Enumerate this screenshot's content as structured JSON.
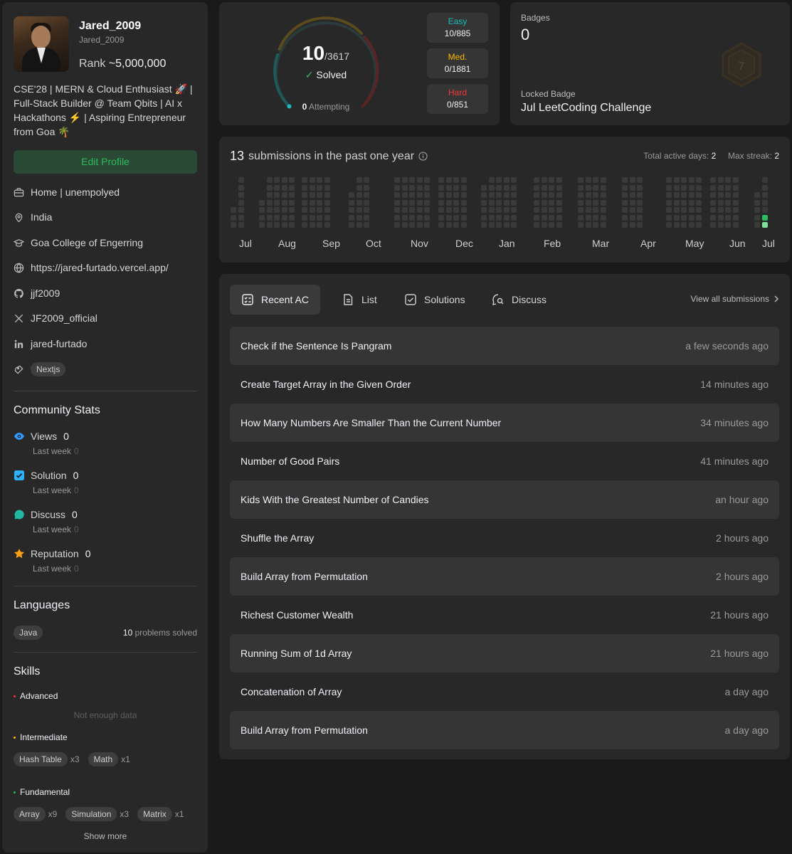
{
  "profile": {
    "username": "Jared_2009",
    "handle": "Jared_2009",
    "rank_label": "Rank",
    "rank_value": "~5,000,000",
    "bio": "CSE'28 | MERN & Cloud Enthusiast 🚀 | Full-Stack Builder @ Team Qbits | AI x Hackathons ⚡ | Aspiring Entrepreneur from Goa 🌴",
    "edit_label": "Edit Profile",
    "work": "Home | unempolyed",
    "location": "India",
    "school": "Goa College of Engerring",
    "website": "https://jared-furtado.vercel.app/",
    "github": "jjf2009",
    "twitter": "JF2009_official",
    "linkedin": "jared-furtado",
    "skill_tag": "Nextjs"
  },
  "community": {
    "title": "Community Stats",
    "items": [
      {
        "label": "Views",
        "value": "0",
        "lw_label": "Last week",
        "lw_value": "0",
        "icon": "eye-icon",
        "color": "#2f9bff"
      },
      {
        "label": "Solution",
        "value": "0",
        "lw_label": "Last week",
        "lw_value": "0",
        "icon": "solution-icon",
        "color": "#2fb0ff"
      },
      {
        "label": "Discuss",
        "value": "0",
        "lw_label": "Last week",
        "lw_value": "0",
        "icon": "discuss-icon",
        "color": "#1fb8a0"
      },
      {
        "label": "Reputation",
        "value": "0",
        "lw_label": "Last week",
        "lw_value": "0",
        "icon": "star-icon",
        "color": "#ffa116"
      }
    ]
  },
  "languages": {
    "title": "Languages",
    "name": "Java",
    "count": "10",
    "suffix": "problems solved"
  },
  "skills": {
    "title": "Skills",
    "advanced": "Advanced",
    "advanced_empty": "Not enough data",
    "intermediate": "Intermediate",
    "intermediate_items": [
      {
        "name": "Hash Table",
        "count": "x3"
      },
      {
        "name": "Math",
        "count": "x1"
      }
    ],
    "fundamental": "Fundamental",
    "fundamental_items": [
      {
        "name": "Array",
        "count": "x9"
      },
      {
        "name": "Simulation",
        "count": "x3"
      },
      {
        "name": "Matrix",
        "count": "x1"
      }
    ],
    "show_more": "Show more"
  },
  "solved": {
    "count": "10",
    "total": "/3617",
    "solved_label": "Solved",
    "attempting_count": "0",
    "attempting_label": "Attempting",
    "easy_label": "Easy",
    "easy_value": "10/885",
    "med_label": "Med.",
    "med_value": "0/1881",
    "hard_label": "Hard",
    "hard_value": "0/851",
    "colors": {
      "easy": "#1cbaba",
      "med": "#ffb700",
      "hard": "#f63737"
    }
  },
  "badges": {
    "title": "Badges",
    "count": "0",
    "locked_label": "Locked Badge",
    "locked_name": "Jul LeetCoding Challenge"
  },
  "heatmap": {
    "count": "13",
    "title": "submissions in the past one year",
    "active_label": "Total active days:",
    "active_value": "2",
    "streak_label": "Max streak:",
    "streak_value": "2",
    "months": [
      "Jul",
      "Aug",
      "Sep",
      "Oct",
      "Nov",
      "Dec",
      "Jan",
      "Feb",
      "Mar",
      "Apr",
      "May",
      "Jun",
      "Jul"
    ]
  },
  "submissions": {
    "tabs": [
      "Recent AC",
      "List",
      "Solutions",
      "Discuss"
    ],
    "view_all": "View all submissions",
    "items": [
      {
        "title": "Check if the Sentence Is Pangram",
        "time": "a few seconds ago"
      },
      {
        "title": "Create Target Array in the Given Order",
        "time": "14 minutes ago"
      },
      {
        "title": "How Many Numbers Are Smaller Than the Current Number",
        "time": "34 minutes ago"
      },
      {
        "title": "Number of Good Pairs",
        "time": "41 minutes ago"
      },
      {
        "title": "Kids With the Greatest Number of Candies",
        "time": "an hour ago"
      },
      {
        "title": "Shuffle the Array",
        "time": "2 hours ago"
      },
      {
        "title": "Build Array from Permutation",
        "time": "2 hours ago"
      },
      {
        "title": "Richest Customer Wealth",
        "time": "21 hours ago"
      },
      {
        "title": "Running Sum of 1d Array",
        "time": "21 hours ago"
      },
      {
        "title": "Concatenation of Array",
        "time": "a day ago"
      },
      {
        "title": "Build Array from Permutation",
        "time": "a day ago"
      }
    ]
  }
}
